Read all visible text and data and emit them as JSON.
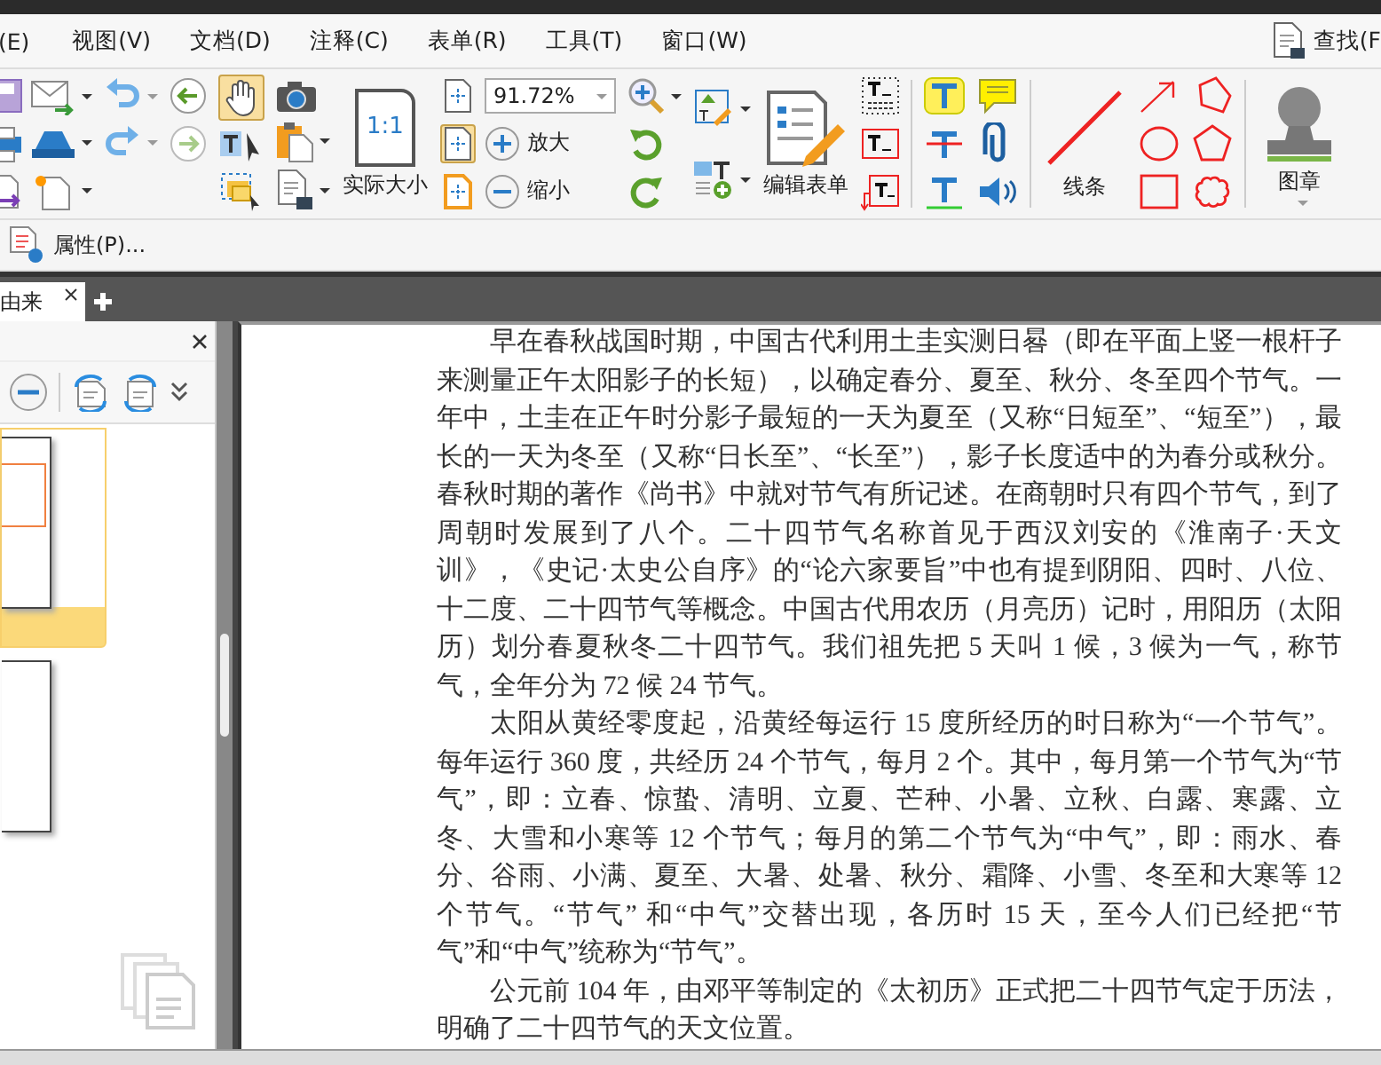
{
  "menu_bar": {
    "items": [
      "(E)",
      "视图(V)",
      "文档(D)",
      "注释(C)",
      "表单(R)",
      "工具(T)",
      "窗口(W)"
    ],
    "find_label": "查找(F"
  },
  "ribbon": {
    "hand_tool": {
      "selected": true
    },
    "fit_buttons": [
      {
        "selected": false
      },
      {
        "selected": true
      },
      {
        "selected": false
      }
    ],
    "actual_size_icon_text": "1:1",
    "actual_size_label": "实际大小",
    "zoom_value": "91.72%",
    "zoom_in_label": "放大",
    "zoom_out_label": "缩小",
    "edit_form_label": "编辑表单",
    "line_label": "线条",
    "stamp_label": "图章"
  },
  "properties_label": "属性(P)...",
  "tabs": [
    {
      "label": "由来",
      "selected": true
    }
  ],
  "thumbnails": [
    {
      "selected": true
    },
    {
      "selected": false
    }
  ],
  "document": {
    "paragraphs": [
      "早在春秋战国时期，中国古代利用土圭实测日晷（即在平面上竖一根杆子来测量正午太阳影子的长短），以确定春分、夏至、秋分、冬至四个节气。一年中，土圭在正午时分影子最短的一天为夏至（又称“日短至”、“短至”），最长的一天为冬至（又称“日长至”、“长至”），影子长度适中的为春分或秋分。春秋时期的著作《尚书》中就对节气有所记述。在商朝时只有四个节气，到了周朝时发展到了八个。二十四节气名称首见于西汉刘安的《淮南子·天文训》，《史记·太史公自序》的“论六家要旨”中也有提到阴阳、四时、八位、十二度、二十四节气等概念。中国古代用农历（月亮历）记时，用阳历（太阳历）划分春夏秋冬二十四节气。我们祖先把 5 天叫 1 候，3 候为一气，称节气，全年分为 72 候 24 节气。",
      "太阳从黄经零度起，沿黄经每运行 15 度所经历的时日称为“一个节气”。每年运行 360 度，共经历 24 个节气，每月 2 个。其中，每月第一个节气为“节气”，即：立春、惊蛰、清明、立夏、芒种、小暑、立秋、白露、寒露、立冬、大雪和小寒等 12 个节气；每月的第二个节气为“中气”，即：雨水、春分、谷雨、小满、夏至、大暑、处暑、秋分、霜降、小雪、冬至和大寒等 12 个节气。“节气” 和“中气”交替出现，各历时 15 天，至今人们已经把“节气”和“中气”统称为“节气”。",
      "公元前 104 年，由邓平等制定的《太初历》正式把二十四节气定于历法，明确了二十四节气的天文位置。"
    ]
  }
}
